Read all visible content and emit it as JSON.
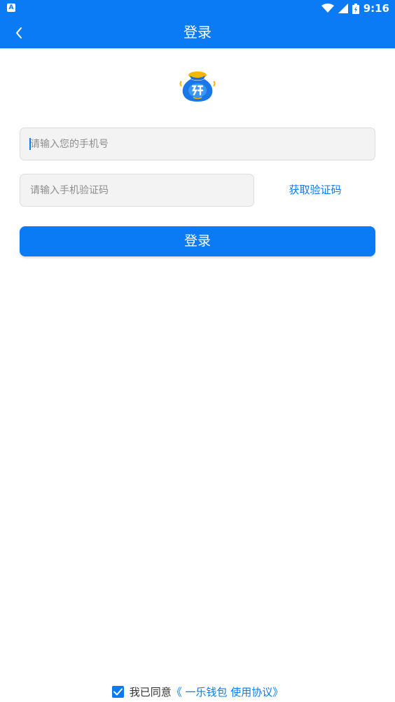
{
  "status_bar": {
    "left_icon_letter": "A",
    "time": "9:16"
  },
  "app_bar": {
    "title": "登录",
    "back_icon": "chevron-left-icon"
  },
  "logo": {
    "icon": "money-bag-logo"
  },
  "form": {
    "phone_placeholder": "请输入您的手机号",
    "phone_value": "",
    "code_placeholder": "请输入手机验证码",
    "code_value": "",
    "get_code_label": "获取验证码",
    "login_label": "登录"
  },
  "agreement": {
    "checked": true,
    "prefix": "我已同意",
    "link": "《 一乐钱包 使用协议》"
  },
  "colors": {
    "primary": "#0a7bf5",
    "field_bg": "#f3f3f3",
    "text": "#333333"
  }
}
